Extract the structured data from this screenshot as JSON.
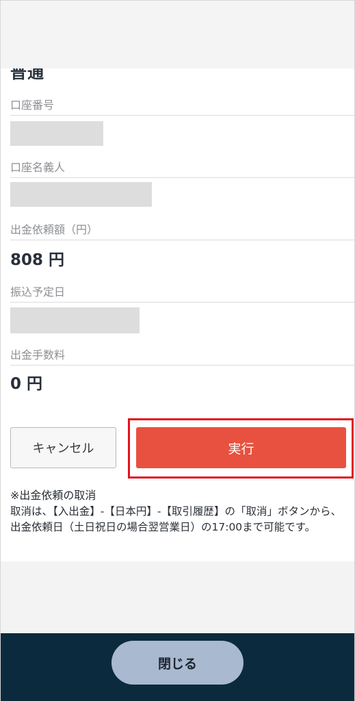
{
  "section_heading_partial": "普通",
  "fields": {
    "account_number_label": "口座番号",
    "account_holder_label": "口座名義人",
    "withdrawal_amount_label": "出金依頼額（円）",
    "withdrawal_amount_value": "808 円",
    "transfer_date_label": "振込予定日",
    "withdrawal_fee_label": "出金手数料",
    "withdrawal_fee_value": "0 円"
  },
  "buttons": {
    "cancel_label": "キャンセル",
    "execute_label": "実行",
    "close_label": "閉じる"
  },
  "notice": {
    "title": "※出金依頼の取消",
    "body": "取消は、【入出金】-【日本円】-【取引履歴】の「取消」ボタンから、出金依頼日（土日祝日の場合翌営業日）の17:00まで可能です。"
  },
  "colors": {
    "execute_button": "#e8513f",
    "highlight_border": "#e3121c",
    "footer_background": "#0b2a3d",
    "close_button": "#a9b9cf"
  }
}
